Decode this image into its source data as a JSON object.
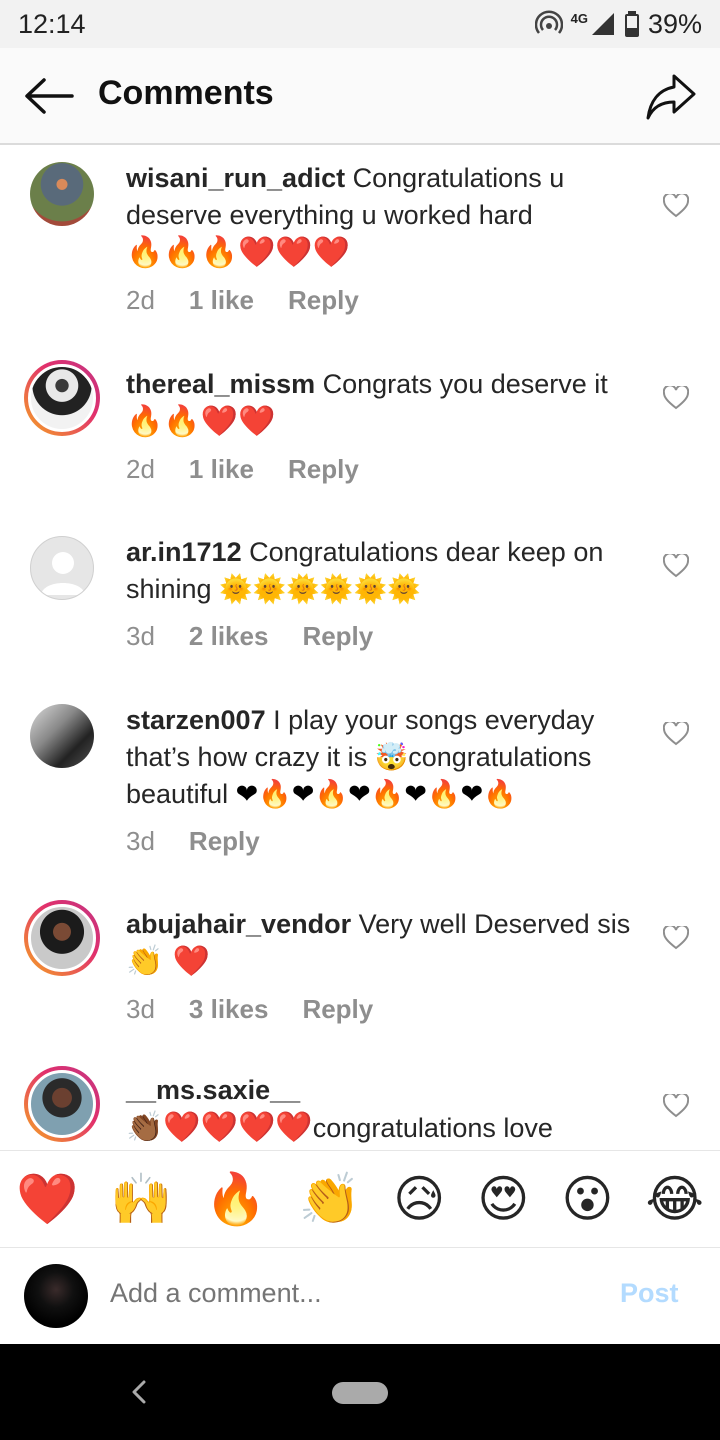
{
  "status": {
    "time": "12:14",
    "network": "4G",
    "battery": "39%"
  },
  "header": {
    "title": "Comments"
  },
  "comments": [
    {
      "user": "wisani_run_adict",
      "text": "Congratulations u deserve everything u worked hard",
      "emojis": "🔥🔥🔥❤️❤️❤️",
      "age": "2d",
      "likes": "1 like",
      "reply": "Reply"
    },
    {
      "user": "thereal_missm",
      "text": "Congrats you deserve it",
      "emojis": "🔥🔥❤️❤️",
      "age": "2d",
      "likes": "1 like",
      "reply": "Reply"
    },
    {
      "user": "ar.in1712",
      "text": "Congratulations dear keep on shining",
      "emojis": "🌞🌞🌞🌞🌞🌞",
      "age": "3d",
      "likes": "2 likes",
      "reply": "Reply"
    },
    {
      "user": "starzen007",
      "text": "I play your songs everyday that’s how crazy it is",
      "emoji_mid": "🤯",
      "text2": "congratulations beautiful",
      "emojis": "❤🔥❤🔥❤🔥❤🔥❤🔥",
      "age": "3d",
      "reply": "Reply"
    },
    {
      "user": "abujahair_vendor",
      "text": "Very well Deserved sis",
      "emojis": "👏 ❤️",
      "age": "3d",
      "likes": "3 likes",
      "reply": "Reply"
    },
    {
      "user": "__ms.saxie__",
      "emojis": "👏🏾❤️❤️❤️❤️",
      "text": "congratulations love"
    }
  ],
  "reactions": [
    "❤️",
    "🙌",
    "🔥",
    "👏",
    "😥",
    "😍",
    "😮",
    "😂"
  ],
  "composer": {
    "placeholder": "Add a comment...",
    "post": "Post"
  }
}
